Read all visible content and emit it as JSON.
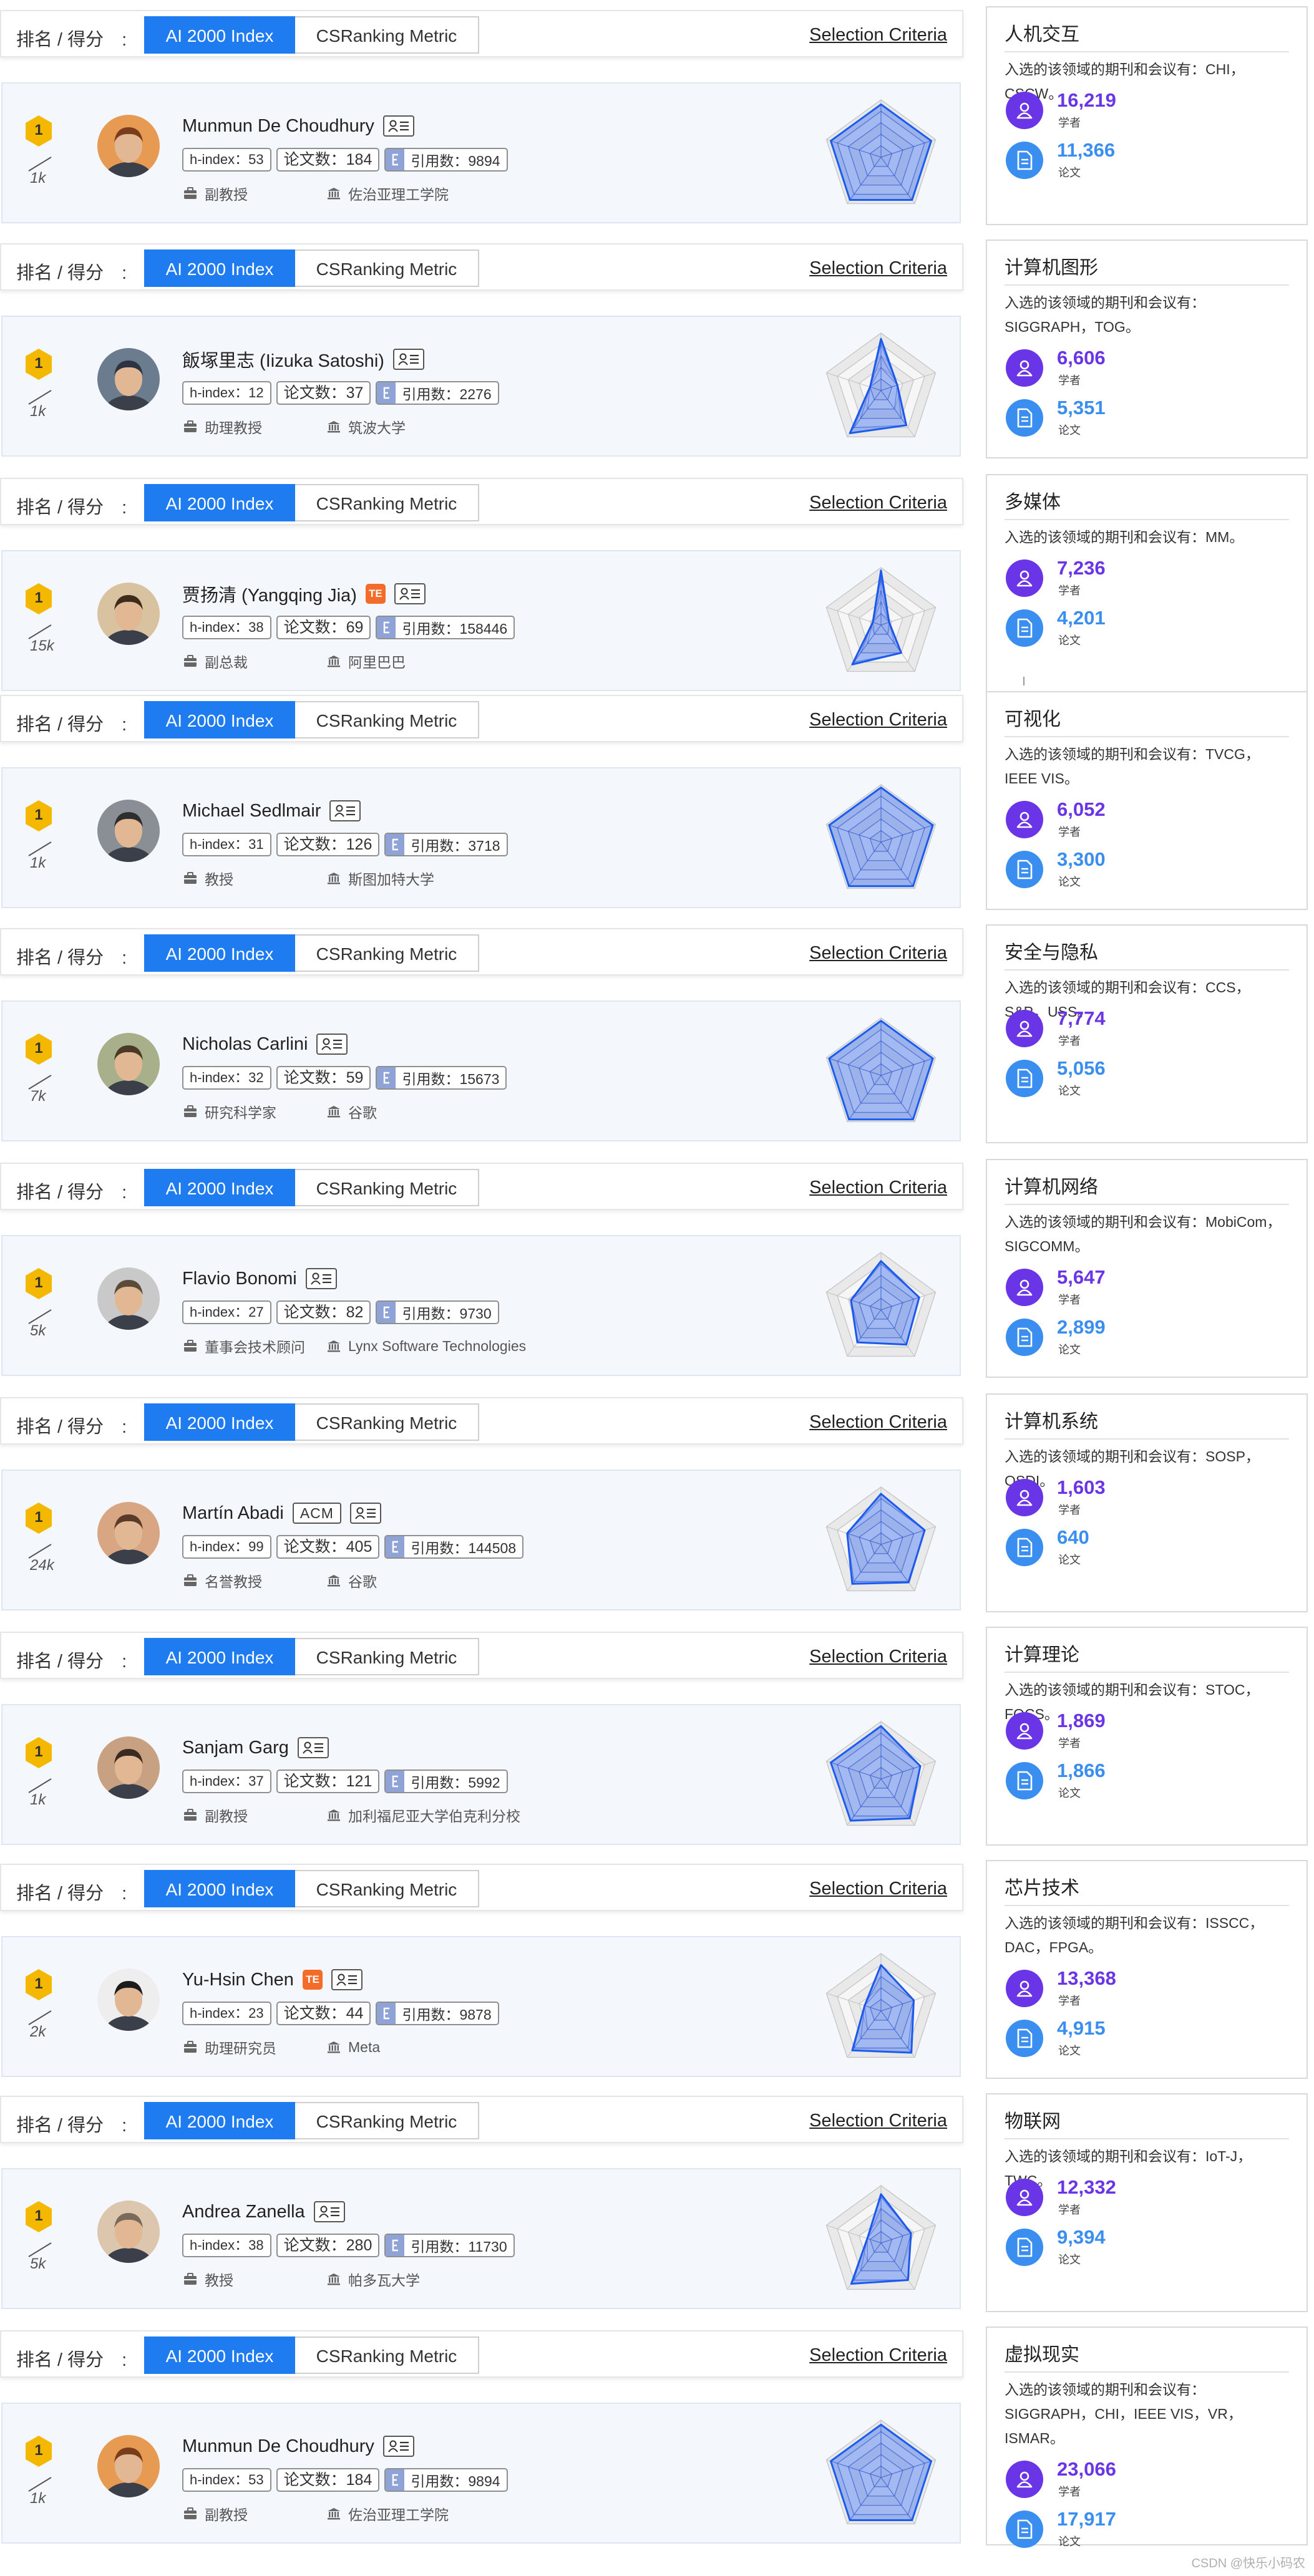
{
  "controls": {
    "rank_label": "排名 / 得分　:",
    "tab_active": "AI 2000 Index",
    "tab_inactive": "CSRanking Metric",
    "criteria": "Selection Criteria"
  },
  "labels": {
    "h_index": "h-index：",
    "papers": "论文数：",
    "citations": "引用数：",
    "scholars": "学者",
    "papers_short": "论文"
  },
  "icons": {
    "bag": "briefcase-icon",
    "org": "institution-icon",
    "profile": "profile-card-icon",
    "cite": "quote-icon",
    "scholar": "user-icon",
    "paper": "document-icon"
  },
  "colors": {
    "accent": "#1e7bf0",
    "scholar_purple": "#6a35e6",
    "paper_blue": "#3a8ef0",
    "badge_yellow": "#f5b800",
    "radar_blue": "#1a5cf0",
    "card_bg": "#f4f8fd"
  },
  "authors": [
    {
      "rank": "1",
      "score": "1k",
      "name": "Munmun De Choudhury",
      "badges": [
        "profile"
      ],
      "h_index": "53",
      "papers": "184",
      "citations": "9894",
      "position": "副教授",
      "org": "佐治亚理工学院",
      "radar": [
        0.92,
        0.92,
        0.92,
        0.92,
        0.92
      ]
    },
    {
      "rank": "1",
      "score": "1k",
      "name": "飯塚里志 (Iizuka Satoshi)",
      "badges": [
        "profile"
      ],
      "h_index": "12",
      "papers": "37",
      "citations": "2276",
      "position": "助理教授",
      "org": "筑波大学",
      "radar": [
        0.9,
        0.3,
        0.75,
        0.92,
        0.2
      ]
    },
    {
      "rank": "1",
      "score": "15k",
      "name": "贾扬清 (Yangqing Jia)",
      "badges": [
        "orange",
        "profile"
      ],
      "h_index": "38",
      "papers": "69",
      "citations": "158446",
      "position": "副总裁",
      "org": "阿里巴巴",
      "radar": [
        0.95,
        0.15,
        0.6,
        0.85,
        0.15
      ]
    },
    {
      "rank": "1",
      "score": "1k",
      "name": "Michael Sedlmair",
      "badges": [
        "profile"
      ],
      "h_index": "31",
      "papers": "126",
      "citations": "3718",
      "position": "教授",
      "org": "斯图加特大学",
      "radar": [
        0.95,
        0.95,
        0.95,
        0.95,
        0.95
      ]
    },
    {
      "rank": "1",
      "score": "7k",
      "name": "Nicholas Carlini",
      "badges": [
        "profile"
      ],
      "h_index": "32",
      "papers": "59",
      "citations": "15673",
      "position": "研究科学家",
      "org": "谷歌",
      "radar": [
        0.95,
        0.95,
        0.95,
        0.95,
        0.95
      ]
    },
    {
      "rank": "1",
      "score": "5k",
      "name": "Flavio Bonomi",
      "badges": [
        "profile"
      ],
      "h_index": "27",
      "papers": "82",
      "citations": "9730",
      "position": "董事会技术顾问",
      "org": "Lynx Software Technologies",
      "radar": [
        0.85,
        0.7,
        0.75,
        0.7,
        0.55
      ]
    },
    {
      "rank": "1",
      "score": "24k",
      "name": "Martín Abadi",
      "badges": [
        "acm",
        "profile"
      ],
      "h_index": "99",
      "papers": "405",
      "citations": "144508",
      "position": "名誉教授",
      "org": "谷歌",
      "radar": [
        0.88,
        0.8,
        0.82,
        0.85,
        0.62
      ]
    },
    {
      "rank": "1",
      "score": "1k",
      "name": "Sanjam Garg",
      "badges": [
        "profile"
      ],
      "h_index": "37",
      "papers": "121",
      "citations": "5992",
      "position": "副教授",
      "org": "加利福尼亚大学伯克利分校",
      "radar": [
        0.92,
        0.72,
        0.85,
        0.9,
        0.92
      ]
    },
    {
      "rank": "1",
      "score": "2k",
      "name": "Yu-Hsin Chen",
      "badges": [
        "orange",
        "profile"
      ],
      "h_index": "23",
      "papers": "44",
      "citations": "9878",
      "position": "助理研究员",
      "org": "Meta",
      "radar": [
        0.8,
        0.6,
        0.9,
        0.85,
        0.3
      ]
    },
    {
      "rank": "1",
      "score": "5k",
      "name": "Andrea Zanella",
      "badges": [
        "profile"
      ],
      "h_index": "38",
      "papers": "280",
      "citations": "11730",
      "position": "教授",
      "org": "帕多瓦大学",
      "radar": [
        0.85,
        0.55,
        0.8,
        0.88,
        0.25
      ]
    },
    {
      "rank": "1",
      "score": "1k",
      "name": "Munmun De Choudhury",
      "badges": [
        "profile"
      ],
      "h_index": "53",
      "papers": "184",
      "citations": "9894",
      "position": "副教授",
      "org": "佐治亚理工学院",
      "radar": [
        0.92,
        0.92,
        0.92,
        0.92,
        0.92
      ]
    }
  ],
  "domains": [
    {
      "title": "人机交互",
      "desc": "入选的该领域的期刊和会议有：CHI，CSCW。",
      "scholars": "16,219",
      "papers": "11,366"
    },
    {
      "title": "计算机图形",
      "desc": "入选的该领域的期刊和会议有：SIGGRAPH，TOG。",
      "scholars": "6,606",
      "papers": "5,351"
    },
    {
      "title": "多媒体",
      "desc": "入选的该领域的期刊和会议有：MM。",
      "scholars": "7,236",
      "papers": "4,201"
    },
    {
      "title": "可视化",
      "desc": "入选的该领域的期刊和会议有：TVCG，IEEE VIS。",
      "scholars": "6,052",
      "papers": "3,300"
    },
    {
      "title": "安全与隐私",
      "desc": "入选的该领域的期刊和会议有：CCS，S&P，USS。",
      "scholars": "7,774",
      "papers": "5,056"
    },
    {
      "title": "计算机网络",
      "desc": "入选的该领域的期刊和会议有：MobiCom，SIGCOMM。",
      "scholars": "5,647",
      "papers": "2,899"
    },
    {
      "title": "计算机系统",
      "desc": "入选的该领域的期刊和会议有：SOSP，OSDI。",
      "scholars": "1,603",
      "papers": "640"
    },
    {
      "title": "计算理论",
      "desc": "入选的该领域的期刊和会议有：STOC，FOCS。",
      "scholars": "1,869",
      "papers": "1,866"
    },
    {
      "title": "芯片技术",
      "desc": "入选的该领域的期刊和会议有：ISSCC，DAC，FPGA。",
      "scholars": "13,368",
      "papers": "4,915"
    },
    {
      "title": "物联网",
      "desc": "入选的该领域的期刊和会议有：IoT-J，TWC。",
      "scholars": "12,332",
      "papers": "9,394"
    },
    {
      "title": "虚拟现实",
      "desc": "入选的该领域的期刊和会议有：SIGGRAPH，CHI，IEEE VIS，VR，ISMAR。",
      "scholars": "23,066",
      "papers": "17,917"
    }
  ],
  "watermark": "CSDN @快乐小码农"
}
